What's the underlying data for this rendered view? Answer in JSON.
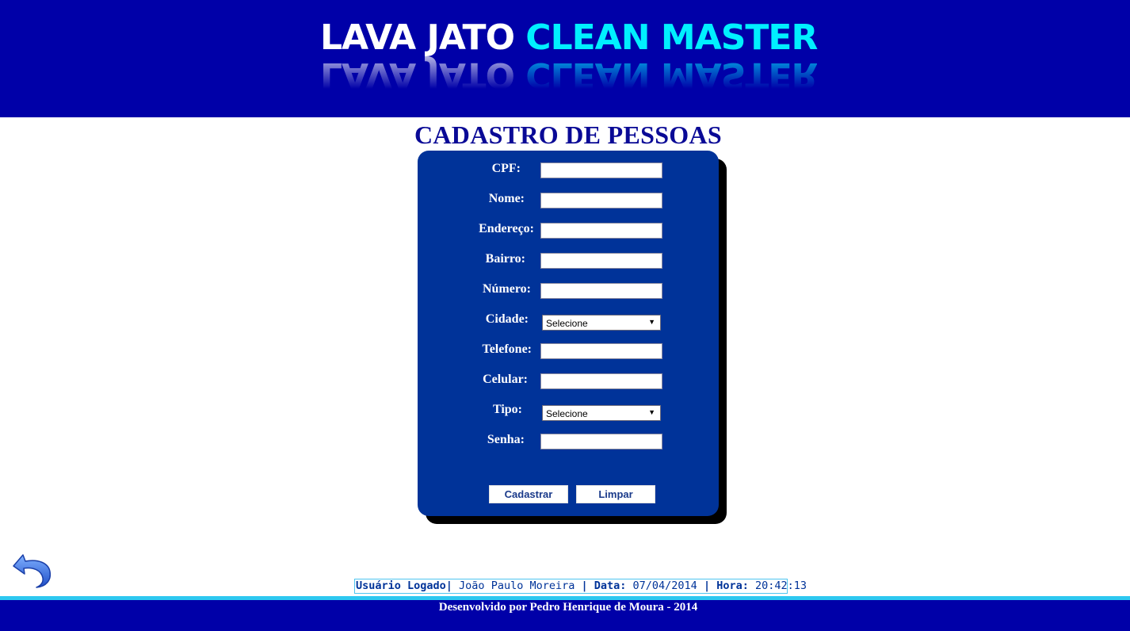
{
  "header": {
    "logo_part1": "LAVA JATO",
    "logo_part2": "CLEAN MASTER"
  },
  "page_title": "CADASTRO DE PESSOAS",
  "form": {
    "fields": [
      {
        "label": "CPF:",
        "type": "text",
        "value": ""
      },
      {
        "label": "Nome:",
        "type": "text",
        "value": ""
      },
      {
        "label": "Endereço:",
        "type": "text",
        "value": ""
      },
      {
        "label": "Bairro:",
        "type": "text",
        "value": ""
      },
      {
        "label": "Número:",
        "type": "text",
        "value": ""
      },
      {
        "label": "Cidade:",
        "type": "select",
        "value": "Selecione"
      },
      {
        "label": "Telefone:",
        "type": "text",
        "value": ""
      },
      {
        "label": "Celular:",
        "type": "text",
        "value": ""
      },
      {
        "label": "Tipo:",
        "type": "select",
        "value": "Selecione"
      },
      {
        "label": "Senha:",
        "type": "password",
        "value": ""
      }
    ],
    "submit_label": "Cadastrar",
    "reset_label": "Limpar"
  },
  "back_icon": "undo-arrow-icon",
  "status": {
    "user_label": "Usuário Logado|",
    "user_value": " João Paulo Moreira ",
    "date_label": "| Data:",
    "date_value": " 07/04/2014 ",
    "time_label": "| Hora:",
    "time_value": " 20:42:13"
  },
  "footer": {
    "text": "Desenvolvido por Pedro Henrique de Moura - 2014"
  },
  "colors": {
    "header_bg": "#0000a8",
    "logo_accent": "#00f0ff",
    "panel_bg": "#003399",
    "title": "#0a0a96",
    "footer_line": "#2dc8f0"
  }
}
